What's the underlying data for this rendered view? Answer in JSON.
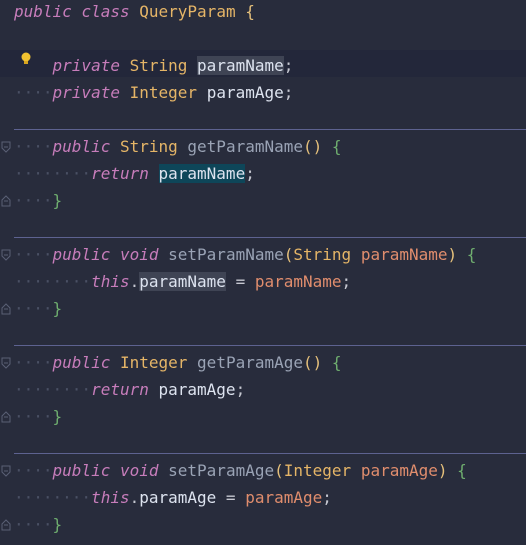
{
  "editor": {
    "lines": [
      {
        "tokens": [
          {
            "t": "public",
            "c": "kw"
          },
          {
            "t": " ",
            "c": "punct"
          },
          {
            "t": "class",
            "c": "kw"
          },
          {
            "t": " ",
            "c": "punct"
          },
          {
            "t": "QueryParam",
            "c": "cls"
          },
          {
            "t": " ",
            "c": "punct"
          },
          {
            "t": "{",
            "c": "brace1"
          }
        ]
      },
      {
        "tokens": []
      },
      {
        "tokens": [
          {
            "t": "    ",
            "c": "dots"
          },
          {
            "t": "private",
            "c": "kw"
          },
          {
            "t": " ",
            "c": "punct"
          },
          {
            "t": "String",
            "c": "cls"
          },
          {
            "t": " ",
            "c": "punct"
          },
          {
            "t": "paramName",
            "c": "field hl-gray"
          },
          {
            "t": ";",
            "c": "punct"
          }
        ]
      },
      {
        "tokens": [
          {
            "t": "····",
            "c": "dots"
          },
          {
            "t": "private",
            "c": "kw"
          },
          {
            "t": " ",
            "c": "punct"
          },
          {
            "t": "Integer",
            "c": "cls"
          },
          {
            "t": " ",
            "c": "punct"
          },
          {
            "t": "paramAge",
            "c": "field"
          },
          {
            "t": ";",
            "c": "punct"
          }
        ]
      },
      {
        "tokens": []
      },
      {
        "tokens": [
          {
            "t": "····",
            "c": "dots"
          },
          {
            "t": "public",
            "c": "kw"
          },
          {
            "t": " ",
            "c": "punct"
          },
          {
            "t": "String",
            "c": "cls"
          },
          {
            "t": " ",
            "c": "punct"
          },
          {
            "t": "getParamName",
            "c": "fn"
          },
          {
            "t": "()",
            "c": "brace1"
          },
          {
            "t": " ",
            "c": "punct"
          },
          {
            "t": "{",
            "c": "brace3"
          }
        ]
      },
      {
        "tokens": [
          {
            "t": "········",
            "c": "dots"
          },
          {
            "t": "return",
            "c": "kw"
          },
          {
            "t": " ",
            "c": "punct"
          },
          {
            "t": "paramName",
            "c": "field hl-teal"
          },
          {
            "t": ";",
            "c": "punct"
          }
        ]
      },
      {
        "tokens": [
          {
            "t": "····",
            "c": "dots"
          },
          {
            "t": "}",
            "c": "brace3"
          }
        ]
      },
      {
        "tokens": []
      },
      {
        "tokens": [
          {
            "t": "····",
            "c": "dots"
          },
          {
            "t": "public",
            "c": "kw"
          },
          {
            "t": " ",
            "c": "punct"
          },
          {
            "t": "void",
            "c": "kw"
          },
          {
            "t": " ",
            "c": "punct"
          },
          {
            "t": "setParamName",
            "c": "fn"
          },
          {
            "t": "(",
            "c": "brace1"
          },
          {
            "t": "String",
            "c": "cls"
          },
          {
            "t": " ",
            "c": "punct"
          },
          {
            "t": "paramName",
            "c": "param"
          },
          {
            "t": ")",
            "c": "brace1"
          },
          {
            "t": " ",
            "c": "punct"
          },
          {
            "t": "{",
            "c": "brace3"
          }
        ]
      },
      {
        "tokens": [
          {
            "t": "········",
            "c": "dots"
          },
          {
            "t": "this",
            "c": "kw"
          },
          {
            "t": ".",
            "c": "punct"
          },
          {
            "t": "paramName",
            "c": "field hl-gray"
          },
          {
            "t": " = ",
            "c": "punct"
          },
          {
            "t": "paramName",
            "c": "param"
          },
          {
            "t": ";",
            "c": "punct"
          }
        ]
      },
      {
        "tokens": [
          {
            "t": "····",
            "c": "dots"
          },
          {
            "t": "}",
            "c": "brace3"
          }
        ]
      },
      {
        "tokens": []
      },
      {
        "tokens": [
          {
            "t": "····",
            "c": "dots"
          },
          {
            "t": "public",
            "c": "kw"
          },
          {
            "t": " ",
            "c": "punct"
          },
          {
            "t": "Integer",
            "c": "cls"
          },
          {
            "t": " ",
            "c": "punct"
          },
          {
            "t": "getParamAge",
            "c": "fn"
          },
          {
            "t": "()",
            "c": "brace1"
          },
          {
            "t": " ",
            "c": "punct"
          },
          {
            "t": "{",
            "c": "brace3"
          }
        ]
      },
      {
        "tokens": [
          {
            "t": "········",
            "c": "dots"
          },
          {
            "t": "return",
            "c": "kw"
          },
          {
            "t": " ",
            "c": "punct"
          },
          {
            "t": "paramAge",
            "c": "field"
          },
          {
            "t": ";",
            "c": "punct"
          }
        ]
      },
      {
        "tokens": [
          {
            "t": "····",
            "c": "dots"
          },
          {
            "t": "}",
            "c": "brace3"
          }
        ]
      },
      {
        "tokens": []
      },
      {
        "tokens": [
          {
            "t": "····",
            "c": "dots"
          },
          {
            "t": "public",
            "c": "kw"
          },
          {
            "t": " ",
            "c": "punct"
          },
          {
            "t": "void",
            "c": "kw"
          },
          {
            "t": " ",
            "c": "punct"
          },
          {
            "t": "setParamAge",
            "c": "fn"
          },
          {
            "t": "(",
            "c": "brace1"
          },
          {
            "t": "Integer",
            "c": "cls"
          },
          {
            "t": " ",
            "c": "punct"
          },
          {
            "t": "paramAge",
            "c": "param"
          },
          {
            "t": ")",
            "c": "brace1"
          },
          {
            "t": " ",
            "c": "punct"
          },
          {
            "t": "{",
            "c": "brace3"
          }
        ]
      },
      {
        "tokens": [
          {
            "t": "········",
            "c": "dots"
          },
          {
            "t": "this",
            "c": "kw"
          },
          {
            "t": ".",
            "c": "punct"
          },
          {
            "t": "paramAge",
            "c": "field"
          },
          {
            "t": " = ",
            "c": "punct"
          },
          {
            "t": "paramAge",
            "c": "param"
          },
          {
            "t": ";",
            "c": "punct"
          }
        ]
      },
      {
        "tokens": [
          {
            "t": "····",
            "c": "dots"
          },
          {
            "t": "}",
            "c": "brace3"
          }
        ]
      }
    ],
    "gutter_icons": {
      "intention": "lightbulb-icon",
      "fold": "fold-marker-icon"
    },
    "colors": {
      "background": "#282c3c",
      "keyword": "#c77dbb",
      "type": "#e5b567",
      "method": "#9aa3b5",
      "field": "#dde3ef",
      "parameter": "#e08d6d",
      "separator": "#5d6290"
    }
  }
}
